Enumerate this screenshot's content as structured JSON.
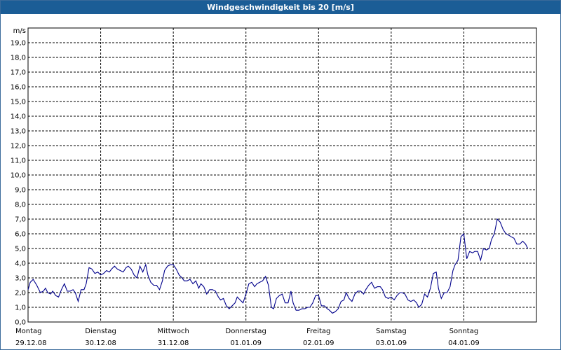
{
  "title": "Windgeschwindigkeit bis 20 [m/s]",
  "colors": {
    "titlebar": "#1b5d96",
    "line": "#00008b",
    "grid": "#000000"
  },
  "chart_data": {
    "type": "line",
    "title": "Windgeschwindigkeit bis 20 [m/s]",
    "ylabel": "m/s",
    "xlabel": "",
    "ylim": [
      0,
      20
    ],
    "grid": true,
    "y_ticks": [
      "0,0",
      "1,0",
      "2,0",
      "3,0",
      "4,0",
      "5,0",
      "6,0",
      "7,0",
      "8,0",
      "9,0",
      "10,0",
      "11,0",
      "12,0",
      "13,0",
      "14,0",
      "15,0",
      "16,0",
      "17,0",
      "18,0",
      "19,0"
    ],
    "x_ticks": [
      {
        "day": "Montag",
        "date": "29.12.08"
      },
      {
        "day": "Dienstag",
        "date": "30.12.08"
      },
      {
        "day": "Mittwoch",
        "date": "31.12.08"
      },
      {
        "day": "Donnerstag",
        "date": "01.01.09"
      },
      {
        "day": "Freitag",
        "date": "02.01.09"
      },
      {
        "day": "Samstag",
        "date": "03.01.09"
      },
      {
        "day": "Sonntag",
        "date": "04.01.09"
      }
    ],
    "xlim_days": [
      0,
      7
    ],
    "series": [
      {
        "points": [
          [
            0.0,
            2.2
          ],
          [
            0.03,
            2.7
          ],
          [
            0.07,
            2.9
          ],
          [
            0.12,
            2.5
          ],
          [
            0.17,
            2.0
          ],
          [
            0.21,
            2.1
          ],
          [
            0.24,
            2.3
          ],
          [
            0.27,
            2.0
          ],
          [
            0.31,
            1.9
          ],
          [
            0.34,
            2.1
          ],
          [
            0.38,
            1.8
          ],
          [
            0.42,
            1.7
          ],
          [
            0.46,
            2.2
          ],
          [
            0.5,
            2.6
          ],
          [
            0.54,
            2.1
          ],
          [
            0.58,
            2.1
          ],
          [
            0.62,
            2.2
          ],
          [
            0.65,
            2.0
          ],
          [
            0.69,
            1.4
          ],
          [
            0.73,
            2.2
          ],
          [
            0.77,
            2.2
          ],
          [
            0.8,
            2.6
          ],
          [
            0.84,
            3.7
          ],
          [
            0.88,
            3.6
          ],
          [
            0.92,
            3.3
          ],
          [
            0.96,
            3.4
          ],
          [
            1.0,
            3.2
          ],
          [
            1.04,
            3.3
          ],
          [
            1.08,
            3.5
          ],
          [
            1.12,
            3.4
          ],
          [
            1.15,
            3.6
          ],
          [
            1.19,
            3.8
          ],
          [
            1.23,
            3.6
          ],
          [
            1.27,
            3.5
          ],
          [
            1.31,
            3.4
          ],
          [
            1.35,
            3.7
          ],
          [
            1.38,
            3.8
          ],
          [
            1.42,
            3.6
          ],
          [
            1.46,
            3.2
          ],
          [
            1.5,
            3.0
          ],
          [
            1.54,
            3.8
          ],
          [
            1.58,
            3.4
          ],
          [
            1.62,
            3.9
          ],
          [
            1.65,
            3.2
          ],
          [
            1.69,
            2.7
          ],
          [
            1.73,
            2.5
          ],
          [
            1.77,
            2.5
          ],
          [
            1.81,
            2.2
          ],
          [
            1.85,
            2.8
          ],
          [
            1.88,
            3.5
          ],
          [
            1.92,
            3.8
          ],
          [
            1.96,
            3.9
          ],
          [
            2.0,
            3.9
          ],
          [
            2.04,
            3.6
          ],
          [
            2.08,
            3.2
          ],
          [
            2.12,
            3.0
          ],
          [
            2.15,
            2.8
          ],
          [
            2.19,
            2.8
          ],
          [
            2.23,
            2.9
          ],
          [
            2.27,
            2.6
          ],
          [
            2.31,
            2.8
          ],
          [
            2.35,
            2.3
          ],
          [
            2.38,
            2.6
          ],
          [
            2.42,
            2.4
          ],
          [
            2.46,
            1.9
          ],
          [
            2.5,
            2.2
          ],
          [
            2.54,
            2.2
          ],
          [
            2.58,
            2.1
          ],
          [
            2.62,
            1.7
          ],
          [
            2.65,
            1.5
          ],
          [
            2.69,
            1.6
          ],
          [
            2.73,
            1.1
          ],
          [
            2.77,
            0.9
          ],
          [
            2.81,
            1.1
          ],
          [
            2.85,
            1.3
          ],
          [
            2.88,
            1.7
          ],
          [
            2.92,
            1.5
          ],
          [
            2.96,
            1.3
          ],
          [
            3.0,
            1.9
          ],
          [
            3.04,
            2.6
          ],
          [
            3.08,
            2.7
          ],
          [
            3.12,
            2.4
          ],
          [
            3.15,
            2.6
          ],
          [
            3.19,
            2.7
          ],
          [
            3.23,
            2.8
          ],
          [
            3.27,
            3.1
          ],
          [
            3.31,
            2.5
          ],
          [
            3.35,
            1.0
          ],
          [
            3.38,
            0.9
          ],
          [
            3.42,
            1.6
          ],
          [
            3.46,
            1.8
          ],
          [
            3.5,
            1.9
          ],
          [
            3.54,
            1.3
          ],
          [
            3.58,
            1.3
          ],
          [
            3.62,
            2.1
          ],
          [
            3.65,
            1.3
          ],
          [
            3.69,
            0.8
          ],
          [
            3.73,
            0.8
          ],
          [
            3.77,
            0.9
          ],
          [
            3.81,
            0.9
          ],
          [
            3.85,
            1.0
          ],
          [
            3.88,
            1.0
          ],
          [
            3.92,
            1.3
          ],
          [
            3.96,
            1.8
          ],
          [
            4.0,
            1.8
          ],
          [
            4.04,
            1.1
          ],
          [
            4.08,
            1.1
          ],
          [
            4.12,
            0.9
          ],
          [
            4.15,
            0.8
          ],
          [
            4.19,
            0.6
          ],
          [
            4.23,
            0.7
          ],
          [
            4.27,
            0.9
          ],
          [
            4.31,
            1.4
          ],
          [
            4.35,
            1.5
          ],
          [
            4.38,
            2.0
          ],
          [
            4.42,
            1.6
          ],
          [
            4.46,
            1.4
          ],
          [
            4.5,
            1.9
          ],
          [
            4.54,
            2.1
          ],
          [
            4.58,
            2.1
          ],
          [
            4.62,
            1.9
          ],
          [
            4.65,
            2.2
          ],
          [
            4.69,
            2.5
          ],
          [
            4.73,
            2.7
          ],
          [
            4.77,
            2.3
          ],
          [
            4.81,
            2.4
          ],
          [
            4.85,
            2.4
          ],
          [
            4.88,
            2.2
          ],
          [
            4.92,
            1.7
          ],
          [
            4.96,
            1.6
          ],
          [
            5.0,
            1.7
          ],
          [
            5.04,
            1.5
          ],
          [
            5.08,
            1.8
          ],
          [
            5.12,
            2.0
          ],
          [
            5.15,
            2.0
          ],
          [
            5.19,
            1.9
          ],
          [
            5.23,
            1.5
          ],
          [
            5.27,
            1.4
          ],
          [
            5.31,
            1.5
          ],
          [
            5.35,
            1.3
          ],
          [
            5.38,
            1.0
          ],
          [
            5.42,
            1.2
          ],
          [
            5.46,
            1.9
          ],
          [
            5.5,
            1.7
          ],
          [
            5.54,
            2.3
          ],
          [
            5.58,
            3.3
          ],
          [
            5.62,
            3.4
          ],
          [
            5.65,
            2.3
          ],
          [
            5.69,
            1.6
          ],
          [
            5.73,
            2.0
          ],
          [
            5.77,
            2.0
          ],
          [
            5.81,
            2.4
          ],
          [
            5.85,
            3.5
          ],
          [
            5.88,
            3.9
          ],
          [
            5.92,
            4.2
          ],
          [
            5.96,
            5.8
          ],
          [
            6.0,
            6.0
          ],
          [
            6.04,
            4.3
          ],
          [
            6.08,
            4.8
          ],
          [
            6.12,
            4.7
          ],
          [
            6.15,
            4.8
          ],
          [
            6.19,
            4.8
          ],
          [
            6.23,
            4.2
          ],
          [
            6.27,
            5.0
          ],
          [
            6.31,
            4.9
          ],
          [
            6.35,
            5.0
          ],
          [
            6.38,
            5.6
          ],
          [
            6.42,
            6.0
          ],
          [
            6.46,
            7.0
          ],
          [
            6.5,
            6.8
          ],
          [
            6.54,
            6.3
          ],
          [
            6.58,
            6.0
          ],
          [
            6.62,
            5.9
          ],
          [
            6.65,
            5.8
          ],
          [
            6.69,
            5.7
          ],
          [
            6.73,
            5.3
          ],
          [
            6.77,
            5.3
          ],
          [
            6.81,
            5.5
          ],
          [
            6.85,
            5.3
          ],
          [
            6.88,
            5.0
          ]
        ]
      }
    ]
  }
}
